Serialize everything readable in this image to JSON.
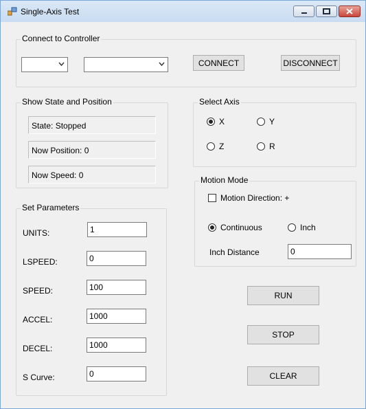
{
  "window": {
    "title": "Single-Axis Test"
  },
  "connect": {
    "legend": "Connect to Controller",
    "combo1_value": "",
    "combo2_value": "",
    "connect_label": "CONNECT",
    "disconnect_label": "DISCONNECT"
  },
  "state": {
    "legend": "Show State and Position",
    "state_text": "State: Stopped",
    "position_text": "Now Position: 0",
    "speed_text": "Now Speed: 0"
  },
  "axis": {
    "legend": "Select Axis",
    "options": [
      {
        "label": "X",
        "selected": true
      },
      {
        "label": "Y",
        "selected": false
      },
      {
        "label": "Z",
        "selected": false
      },
      {
        "label": "R",
        "selected": false
      }
    ]
  },
  "motion": {
    "legend": "Motion Mode",
    "direction_label": "Motion Direction: +",
    "direction_checked": false,
    "continuous_label": "Continuous",
    "inch_label": "Inch",
    "mode_selected": "Continuous",
    "inch_distance_label": "Inch Distance",
    "inch_distance_value": "0"
  },
  "params": {
    "legend": "Set Parameters",
    "items": [
      {
        "label": "UNITS:",
        "value": "1"
      },
      {
        "label": "LSPEED:",
        "value": "0"
      },
      {
        "label": "SPEED:",
        "value": "100"
      },
      {
        "label": "ACCEL:",
        "value": "1000"
      },
      {
        "label": "DECEL:",
        "value": "1000"
      },
      {
        "label": "S Curve:",
        "value": "0"
      }
    ]
  },
  "actions": {
    "run_label": "RUN",
    "stop_label": "STOP",
    "clear_label": "CLEAR"
  }
}
